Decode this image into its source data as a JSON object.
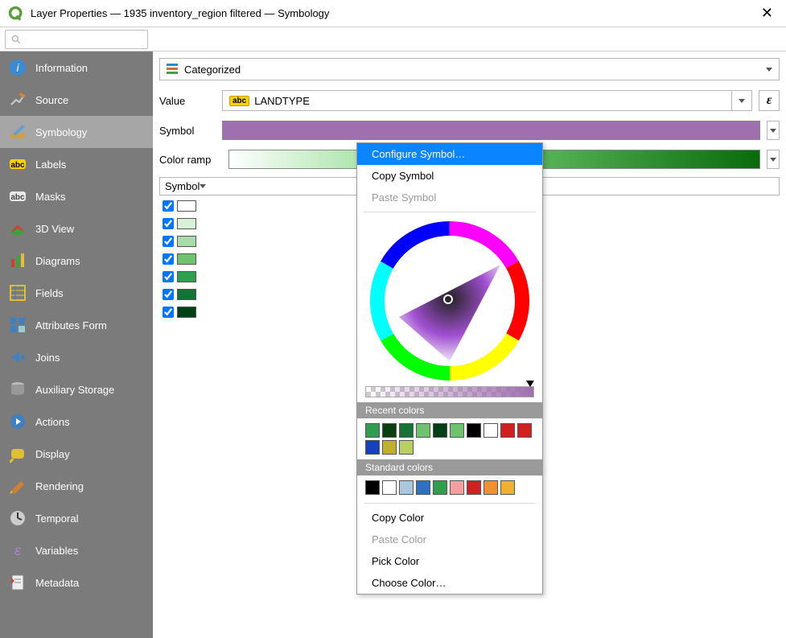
{
  "window": {
    "title": "Layer Properties — 1935 inventory_region filtered — Symbology"
  },
  "sidebar": {
    "items": [
      {
        "label": "Information"
      },
      {
        "label": "Source"
      },
      {
        "label": "Symbology"
      },
      {
        "label": "Labels"
      },
      {
        "label": "Masks"
      },
      {
        "label": "3D View"
      },
      {
        "label": "Diagrams"
      },
      {
        "label": "Fields"
      },
      {
        "label": "Attributes Form"
      },
      {
        "label": "Joins"
      },
      {
        "label": "Auxiliary Storage"
      },
      {
        "label": "Actions"
      },
      {
        "label": "Display"
      },
      {
        "label": "Rendering"
      },
      {
        "label": "Temporal"
      },
      {
        "label": "Variables"
      },
      {
        "label": "Metadata"
      }
    ],
    "active_index": 2
  },
  "symbology": {
    "renderer_type": "Categorized",
    "value_label": "Value",
    "value_field_type": "abc",
    "value_field": "LANDTYPE",
    "symbol_label": "Symbol",
    "symbol_color": "#a06fb0",
    "color_ramp_label": "Color ramp",
    "table_headers": {
      "symbol": "Symbol"
    },
    "rows": [
      {
        "checked": true,
        "color": "#ffffff"
      },
      {
        "checked": true,
        "color": "#d7f0d7"
      },
      {
        "checked": true,
        "color": "#a8dca8"
      },
      {
        "checked": true,
        "color": "#6fc36f"
      },
      {
        "checked": true,
        "color": "#2f9e4f"
      },
      {
        "checked": true,
        "color": "#157335"
      },
      {
        "checked": true,
        "color": "#004015"
      }
    ]
  },
  "popup": {
    "configure": "Configure Symbol…",
    "copy_symbol": "Copy Symbol",
    "paste_symbol": "Paste Symbol",
    "recent_header": "Recent colors",
    "recent_colors": [
      "#2f9e4f",
      "#0a4010",
      "#157335",
      "#6fc36f",
      "#004015",
      "#6fc36f",
      "#000000",
      "#ffffff",
      "#d12020",
      "#d12020",
      "#1540c0",
      "#c0b030",
      "#b8d060"
    ],
    "standard_header": "Standard colors",
    "standard_colors": [
      "#000000",
      "#ffffff",
      "#a8c8e0",
      "#3070c0",
      "#2f9e4f",
      "#f5a0a0",
      "#d12020",
      "#f09030",
      "#f0b030"
    ],
    "copy_color": "Copy Color",
    "paste_color": "Paste Color",
    "pick_color": "Pick Color",
    "choose_color": "Choose Color…"
  }
}
